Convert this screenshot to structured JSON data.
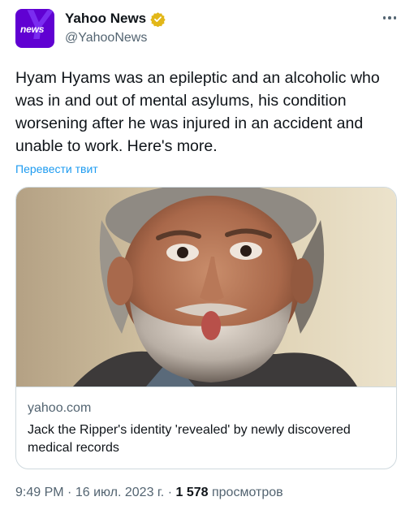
{
  "author": {
    "logo_text": "news",
    "display_name": "Yahoo News",
    "handle": "@YahooNews",
    "verified_badge_color": "#e2b719"
  },
  "tweet": {
    "text": "Hyam Hyams was an epileptic and an alcoholic who was in and out of mental asylums, his condition worsening after he was injured in an accident and unable to work. Here's more.",
    "translate_label": "Перевести твит"
  },
  "card": {
    "domain": "yahoo.com",
    "title": "Jack the Ripper's identity 'revealed' by newly discovered medical records"
  },
  "meta": {
    "time": "9:49 PM",
    "sep": "·",
    "date": "16 июл. 2023 г.",
    "views_count": "1 578",
    "views_label": "просмотров"
  },
  "colors": {
    "accent": "#1d9bf0",
    "brand": "#6001d2",
    "secondary_text": "#536471"
  }
}
